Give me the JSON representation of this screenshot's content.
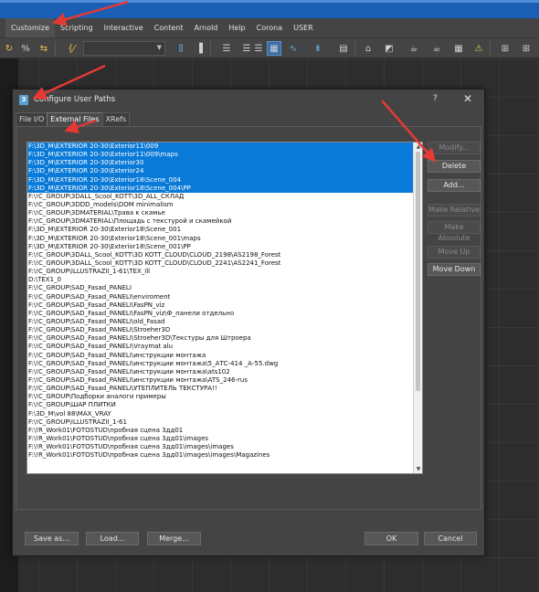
{
  "menubar": {
    "items": [
      "Customize",
      "Scripting",
      "Interactive",
      "Content",
      "Arnold",
      "Help",
      "Corona",
      "USER"
    ]
  },
  "toolbar": {
    "icons": [
      "link-icon",
      "unlink-icon",
      "bind-icon",
      "selection-filter-icon",
      "select-object-icon",
      "select-by-name-icon",
      "rectangular-selection-icon",
      "window-crossing-icon",
      "move-icon",
      "rotate-icon",
      "scale-icon",
      "reference-coordinate-icon",
      "snaps-toggle-icon",
      "angle-snap-icon",
      "percent-snap-icon",
      "spinner-snap-icon",
      "named-selection-icon",
      "mirror-icon",
      "align-icon",
      "layer-explorer-icon",
      "scene-explorer-icon",
      "curve-editor-icon",
      "schematic-view-icon",
      "material-editor-icon",
      "render-setup-icon",
      "rendered-frame-icon",
      "render-icon",
      "render-iterative-icon",
      "active-shade-icon",
      "corona-render-icon",
      "corona-vfb-icon",
      "warning-icon",
      "grid-icon"
    ]
  },
  "dialog": {
    "title": "Configure User Paths",
    "help": "?",
    "close": "✕",
    "tabs": [
      "File I/O",
      "External Files",
      "XRefs"
    ],
    "active_tab": "External Files",
    "paths": [
      {
        "text": "F:\\3D_M\\EXTERIOR 20-30\\Exterior11\\009",
        "selected": true
      },
      {
        "text": "F:\\3D_M\\EXTERIOR 20-30\\Exterior11\\009\\maps",
        "selected": true
      },
      {
        "text": "F:\\3D_M\\EXTERIOR 20-30\\Exterior30",
        "selected": true
      },
      {
        "text": "F:\\3D_M\\EXTERIOR 20-30\\Exterior24",
        "selected": true
      },
      {
        "text": "F:\\3D_M\\EXTERIOR 20-30\\Exterior18\\Scene_004",
        "selected": true
      },
      {
        "text": "F:\\3D_M\\EXTERIOR 20-30\\Exterior18\\Scene_004\\PP",
        "selected": true
      },
      {
        "text": "F:\\!C_GROUP\\3DALL_Scool_KOTT\\3D_ALL_СКЛАД",
        "selected": false
      },
      {
        "text": "F:\\!C_GROUP\\3DDD_models\\DOM minimalism",
        "selected": false
      },
      {
        "text": "F:\\!C_GROUP\\3DMATERIAL\\Трава к скамье",
        "selected": false
      },
      {
        "text": "F:\\!C_GROUP\\3DMATERIAL\\Площадь с текстурой и скамейкой",
        "selected": false
      },
      {
        "text": "F:\\3D_M\\EXTERIOR 20-30\\Exterior18\\Scene_001",
        "selected": false
      },
      {
        "text": "F:\\3D_M\\EXTERIOR 20-30\\Exterior18\\Scene_001\\maps",
        "selected": false
      },
      {
        "text": "F:\\3D_M\\EXTERIOR 20-30\\Exterior18\\Scene_001\\PP",
        "selected": false
      },
      {
        "text": "F:\\!C_GROUP\\3DALL_Scool_KOTT\\3D KOTT_CLOUD\\CLOUD_2198\\AS2198_Forest",
        "selected": false
      },
      {
        "text": "F:\\!C_GROUP\\3DALL_Scool_KOTT\\3D KOTT_CLOUD\\CLOUD_2241\\AS2241_Forest",
        "selected": false
      },
      {
        "text": "F:\\!C_GROUP\\ILLUSTRAZII_1-61\\TEX_ill",
        "selected": false
      },
      {
        "text": "D:\\TEX1_0",
        "selected": false
      },
      {
        "text": "F:\\!C_GROUP\\SAD_Fasad_PANELI",
        "selected": false
      },
      {
        "text": "F:\\!C_GROUP\\SAD_Fasad_PANELI\\enviroment",
        "selected": false
      },
      {
        "text": "F:\\!C_GROUP\\SAD_Fasad_PANELI\\FasPN_viz",
        "selected": false
      },
      {
        "text": "F:\\!C_GROUP\\SAD_Fasad_PANELI\\FasPN_viz\\Ф_панели отдельно",
        "selected": false
      },
      {
        "text": "F:\\!C_GROUP\\SAD_Fasad_PANELI\\old_Fasad",
        "selected": false
      },
      {
        "text": "F:\\!C_GROUP\\SAD_Fasad_PANELI\\Stroeher3D",
        "selected": false
      },
      {
        "text": "F:\\!C_GROUP\\SAD_Fasad_PANELI\\Stroeher3D\\Текстуры для Штроера",
        "selected": false
      },
      {
        "text": "F:\\!C_GROUP\\SAD_Fasad_PANELI\\Vraymat alu",
        "selected": false
      },
      {
        "text": "F:\\!C_GROUP\\SAD_Fasad_PANELI\\инструкции монтажа",
        "selected": false
      },
      {
        "text": "F:\\!C_GROUP\\SAD_Fasad_PANELI\\инструкции монтажа\\5_АТС-414 _А-55.dwg",
        "selected": false
      },
      {
        "text": "F:\\!C_GROUP\\SAD_Fasad_PANELI\\инструкции монтажа\\ats102",
        "selected": false
      },
      {
        "text": "F:\\!C_GROUP\\SAD_Fasad_PANELI\\инструкции монтажа\\ATS_246-rus",
        "selected": false
      },
      {
        "text": "F:\\!C_GROUP\\SAD_Fasad_PANELI\\УТЕПЛИТЕЛЬ ТЕКСТУРА!!",
        "selected": false
      },
      {
        "text": "F:\\!C_GROUP\\Подборки аналоги примеры",
        "selected": false
      },
      {
        "text": "F:\\!C_GROUP\\ШАР ПЛИТКИ",
        "selected": false
      },
      {
        "text": "F:\\3D_M\\vol 88\\MAX_VRAY",
        "selected": false
      },
      {
        "text": "F:\\!C_GROUP\\ILLUSTRAZII_1-61",
        "selected": false
      },
      {
        "text": "F:\\!R_Work01\\FOTOSTUD\\пробная сцена 3дд01",
        "selected": false
      },
      {
        "text": "F:\\!R_Work01\\FOTOSTUD\\пробная сцена 3дд01\\images",
        "selected": false
      },
      {
        "text": "F:\\!R_Work01\\FOTOSTUD\\пробная сцена 3дд01\\images\\images",
        "selected": false
      },
      {
        "text": "F:\\!R_Work01\\FOTOSTUD\\пробная сцена 3дд01\\images\\images\\Magazines",
        "selected": false
      }
    ],
    "side_buttons": [
      {
        "label": "Modify...",
        "enabled": false
      },
      {
        "label": "Delete",
        "enabled": true
      },
      {
        "label": "Add...",
        "enabled": true
      },
      {
        "label": "Make Relative",
        "enabled": false
      },
      {
        "label": "Make Absolute",
        "enabled": false
      },
      {
        "label": "Move Up",
        "enabled": false
      },
      {
        "label": "Move Down",
        "enabled": true
      }
    ],
    "bottom_buttons": {
      "save_as": "Save as...",
      "load": "Load...",
      "merge": "Merge...",
      "ok": "OK",
      "cancel": "Cancel"
    }
  },
  "colors": {
    "selection": "#0a7ad8",
    "dialog_bg": "#444444",
    "annotation_arrow": "#e53935"
  }
}
